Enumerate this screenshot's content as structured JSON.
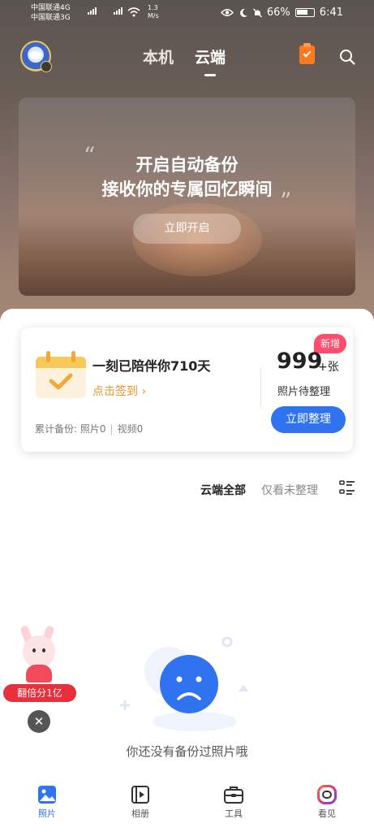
{
  "status_bar": {
    "carrier1": "中国联通4G",
    "carrier2": "中国联通3G",
    "net_speed_value": "1.3",
    "net_speed_unit": "M/s",
    "battery_percent": "66%",
    "time": "6:41"
  },
  "header": {
    "tabs": [
      {
        "label": "本机",
        "active": false
      },
      {
        "label": "云端",
        "active": true
      }
    ]
  },
  "banner": {
    "line1": "开启自动备份",
    "line2": "接收你的专属回忆瞬间",
    "button": "立即开启"
  },
  "card": {
    "days_text": "一刻已陪伴你710天",
    "checkin_link": "点击签到 ›",
    "new_badge": "新增",
    "count": "999",
    "count_suffix": "+张",
    "count_label": "照片待整理",
    "organize_button": "立即整理",
    "backup_label": "累计备份:",
    "photos": "照片0",
    "videos": "视频0"
  },
  "filter": {
    "all": "云端全部",
    "unorganized": "仅看未整理"
  },
  "empty_state": {
    "text": "你还没有备份过照片哦"
  },
  "promo": {
    "label": "翻倍分1亿",
    "close": "✕"
  },
  "bottom_nav": {
    "items": [
      {
        "label": "照片",
        "active": true
      },
      {
        "label": "相册",
        "active": false
      },
      {
        "label": "工具",
        "active": false
      },
      {
        "label": "看见",
        "active": false
      }
    ]
  },
  "colors": {
    "accent_blue": "#2f73f0",
    "orange": "#f2912b",
    "badge_red": "#ff4d6b"
  }
}
